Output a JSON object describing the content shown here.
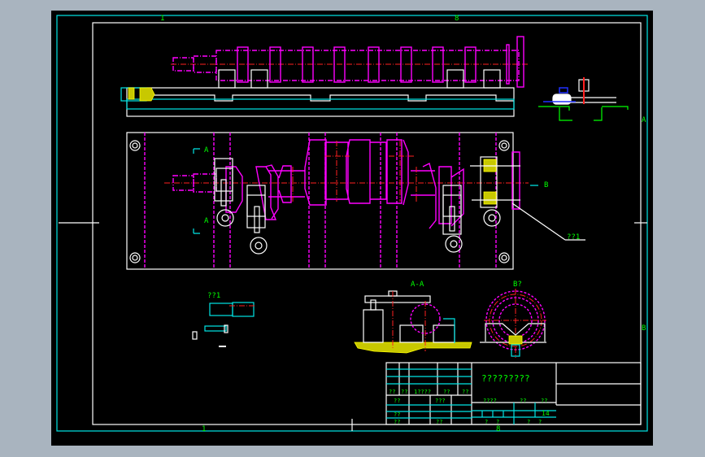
{
  "colors": {
    "background": "#000000",
    "frame": "#ffffff",
    "border": "#00e5e5",
    "workpiece": "#ff00ff",
    "centerline": "#ff2020",
    "text": "#00ff00"
  },
  "zones": {
    "top_left": "1",
    "top_right": "8",
    "bottom_left": "1",
    "bottom_right": "8",
    "right_upper": "A",
    "right_lower": "B"
  },
  "views": {
    "section_a_top": "A",
    "section_a_bottom": "A",
    "view_b_arrow": "B",
    "section_aa_title": "A-A",
    "view_b_title": "B?",
    "leader_label": "??1",
    "detail_label": "??1"
  },
  "title_block": {
    "drawing_name": "?????????",
    "left_headers": [
      "??",
      "??",
      "1????",
      "??",
      "??"
    ],
    "left_rows": [
      "??",
      "???",
      "??",
      "??",
      "??"
    ],
    "mid_headers": [
      "????",
      "??",
      "??"
    ],
    "scale_value": "14",
    "bottom_cells": [
      "?",
      "?",
      "?",
      "?"
    ]
  }
}
